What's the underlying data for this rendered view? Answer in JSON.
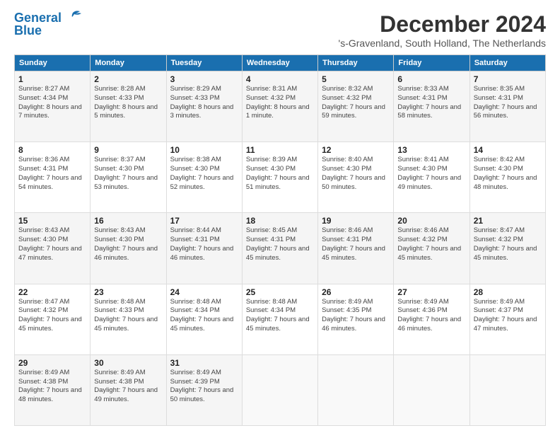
{
  "logo": {
    "line1": "General",
    "line2": "Blue"
  },
  "title": "December 2024",
  "location": "'s-Gravenland, South Holland, The Netherlands",
  "days_header": [
    "Sunday",
    "Monday",
    "Tuesday",
    "Wednesday",
    "Thursday",
    "Friday",
    "Saturday"
  ],
  "weeks": [
    [
      {
        "day": "1",
        "sunrise": "Sunrise: 8:27 AM",
        "sunset": "Sunset: 4:34 PM",
        "daylight": "Daylight: 8 hours and 7 minutes."
      },
      {
        "day": "2",
        "sunrise": "Sunrise: 8:28 AM",
        "sunset": "Sunset: 4:33 PM",
        "daylight": "Daylight: 8 hours and 5 minutes."
      },
      {
        "day": "3",
        "sunrise": "Sunrise: 8:29 AM",
        "sunset": "Sunset: 4:33 PM",
        "daylight": "Daylight: 8 hours and 3 minutes."
      },
      {
        "day": "4",
        "sunrise": "Sunrise: 8:31 AM",
        "sunset": "Sunset: 4:32 PM",
        "daylight": "Daylight: 8 hours and 1 minute."
      },
      {
        "day": "5",
        "sunrise": "Sunrise: 8:32 AM",
        "sunset": "Sunset: 4:32 PM",
        "daylight": "Daylight: 7 hours and 59 minutes."
      },
      {
        "day": "6",
        "sunrise": "Sunrise: 8:33 AM",
        "sunset": "Sunset: 4:31 PM",
        "daylight": "Daylight: 7 hours and 58 minutes."
      },
      {
        "day": "7",
        "sunrise": "Sunrise: 8:35 AM",
        "sunset": "Sunset: 4:31 PM",
        "daylight": "Daylight: 7 hours and 56 minutes."
      }
    ],
    [
      {
        "day": "8",
        "sunrise": "Sunrise: 8:36 AM",
        "sunset": "Sunset: 4:31 PM",
        "daylight": "Daylight: 7 hours and 54 minutes."
      },
      {
        "day": "9",
        "sunrise": "Sunrise: 8:37 AM",
        "sunset": "Sunset: 4:30 PM",
        "daylight": "Daylight: 7 hours and 53 minutes."
      },
      {
        "day": "10",
        "sunrise": "Sunrise: 8:38 AM",
        "sunset": "Sunset: 4:30 PM",
        "daylight": "Daylight: 7 hours and 52 minutes."
      },
      {
        "day": "11",
        "sunrise": "Sunrise: 8:39 AM",
        "sunset": "Sunset: 4:30 PM",
        "daylight": "Daylight: 7 hours and 51 minutes."
      },
      {
        "day": "12",
        "sunrise": "Sunrise: 8:40 AM",
        "sunset": "Sunset: 4:30 PM",
        "daylight": "Daylight: 7 hours and 50 minutes."
      },
      {
        "day": "13",
        "sunrise": "Sunrise: 8:41 AM",
        "sunset": "Sunset: 4:30 PM",
        "daylight": "Daylight: 7 hours and 49 minutes."
      },
      {
        "day": "14",
        "sunrise": "Sunrise: 8:42 AM",
        "sunset": "Sunset: 4:30 PM",
        "daylight": "Daylight: 7 hours and 48 minutes."
      }
    ],
    [
      {
        "day": "15",
        "sunrise": "Sunrise: 8:43 AM",
        "sunset": "Sunset: 4:30 PM",
        "daylight": "Daylight: 7 hours and 47 minutes."
      },
      {
        "day": "16",
        "sunrise": "Sunrise: 8:43 AM",
        "sunset": "Sunset: 4:30 PM",
        "daylight": "Daylight: 7 hours and 46 minutes."
      },
      {
        "day": "17",
        "sunrise": "Sunrise: 8:44 AM",
        "sunset": "Sunset: 4:31 PM",
        "daylight": "Daylight: 7 hours and 46 minutes."
      },
      {
        "day": "18",
        "sunrise": "Sunrise: 8:45 AM",
        "sunset": "Sunset: 4:31 PM",
        "daylight": "Daylight: 7 hours and 45 minutes."
      },
      {
        "day": "19",
        "sunrise": "Sunrise: 8:46 AM",
        "sunset": "Sunset: 4:31 PM",
        "daylight": "Daylight: 7 hours and 45 minutes."
      },
      {
        "day": "20",
        "sunrise": "Sunrise: 8:46 AM",
        "sunset": "Sunset: 4:32 PM",
        "daylight": "Daylight: 7 hours and 45 minutes."
      },
      {
        "day": "21",
        "sunrise": "Sunrise: 8:47 AM",
        "sunset": "Sunset: 4:32 PM",
        "daylight": "Daylight: 7 hours and 45 minutes."
      }
    ],
    [
      {
        "day": "22",
        "sunrise": "Sunrise: 8:47 AM",
        "sunset": "Sunset: 4:32 PM",
        "daylight": "Daylight: 7 hours and 45 minutes."
      },
      {
        "day": "23",
        "sunrise": "Sunrise: 8:48 AM",
        "sunset": "Sunset: 4:33 PM",
        "daylight": "Daylight: 7 hours and 45 minutes."
      },
      {
        "day": "24",
        "sunrise": "Sunrise: 8:48 AM",
        "sunset": "Sunset: 4:34 PM",
        "daylight": "Daylight: 7 hours and 45 minutes."
      },
      {
        "day": "25",
        "sunrise": "Sunrise: 8:48 AM",
        "sunset": "Sunset: 4:34 PM",
        "daylight": "Daylight: 7 hours and 45 minutes."
      },
      {
        "day": "26",
        "sunrise": "Sunrise: 8:49 AM",
        "sunset": "Sunset: 4:35 PM",
        "daylight": "Daylight: 7 hours and 46 minutes."
      },
      {
        "day": "27",
        "sunrise": "Sunrise: 8:49 AM",
        "sunset": "Sunset: 4:36 PM",
        "daylight": "Daylight: 7 hours and 46 minutes."
      },
      {
        "day": "28",
        "sunrise": "Sunrise: 8:49 AM",
        "sunset": "Sunset: 4:37 PM",
        "daylight": "Daylight: 7 hours and 47 minutes."
      }
    ],
    [
      {
        "day": "29",
        "sunrise": "Sunrise: 8:49 AM",
        "sunset": "Sunset: 4:38 PM",
        "daylight": "Daylight: 7 hours and 48 minutes."
      },
      {
        "day": "30",
        "sunrise": "Sunrise: 8:49 AM",
        "sunset": "Sunset: 4:38 PM",
        "daylight": "Daylight: 7 hours and 49 minutes."
      },
      {
        "day": "31",
        "sunrise": "Sunrise: 8:49 AM",
        "sunset": "Sunset: 4:39 PM",
        "daylight": "Daylight: 7 hours and 50 minutes."
      },
      null,
      null,
      null,
      null
    ]
  ]
}
